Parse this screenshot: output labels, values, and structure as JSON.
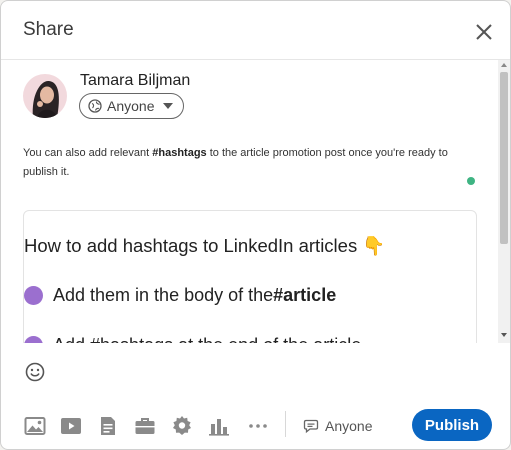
{
  "header": {
    "title": "Share"
  },
  "author": {
    "name": "Tamara Biljman",
    "audience": "Anyone"
  },
  "caption": {
    "pre": "You can also add relevant ",
    "hashtag": "#hashtags",
    "post": " to the article promotion post once you're ready to publish it."
  },
  "article": {
    "title": "How to add hashtags to LinkedIn articles 👇",
    "point1_text": "Add them in the body of the ",
    "point1_bold": "#article",
    "point2_text": "Add #hashtags at the end of the article"
  },
  "toolbar": {
    "icons": [
      "photo-icon",
      "video-icon",
      "document-icon",
      "briefcase-icon",
      "badge-icon",
      "poll-icon",
      "more-icon"
    ],
    "comment_audience": "Anyone",
    "publish_label": "Publish"
  },
  "colors": {
    "accent": "#0a66c2",
    "bullet": "#9b6fcf",
    "online": "#3fb483"
  }
}
